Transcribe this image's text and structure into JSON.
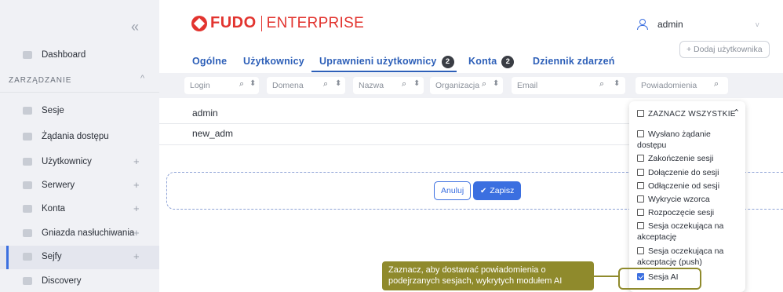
{
  "sidebar": {
    "collapse_glyph": "«",
    "section_title": "ZARZĄDZANIE",
    "items": [
      {
        "label": "Dashboard",
        "icon": "dashboard-icon"
      },
      {
        "label": "Sesje",
        "icon": "sessions-icon"
      },
      {
        "label": "Żądania dostępu",
        "icon": "access-requests-icon"
      },
      {
        "label": "Użytkownicy",
        "icon": "users-icon"
      },
      {
        "label": "Serwery",
        "icon": "servers-icon"
      },
      {
        "label": "Konta",
        "icon": "accounts-icon"
      },
      {
        "label": "Gniazda nasłuchiwania",
        "icon": "listeners-icon"
      },
      {
        "label": "Sejfy",
        "icon": "safes-icon"
      },
      {
        "label": "Discovery",
        "icon": "discovery-icon"
      }
    ],
    "plus": "+"
  },
  "header": {
    "logo_main": "FUDO",
    "logo_sub": "ENTERPRISE",
    "user_name": "admin",
    "add_user_label": "+ Dodaj użytkownika"
  },
  "tabs": [
    {
      "label": "Ogólne"
    },
    {
      "label": "Użytkownicy"
    },
    {
      "label": "Uprawnieni użytkownicy",
      "badge": "2"
    },
    {
      "label": "Konta",
      "badge": "2"
    },
    {
      "label": "Dziennik zdarzeń"
    }
  ],
  "filters": [
    {
      "placeholder": "Login"
    },
    {
      "placeholder": "Domena"
    },
    {
      "placeholder": "Nazwa"
    },
    {
      "placeholder": "Organizacja"
    },
    {
      "placeholder": "Email"
    },
    {
      "placeholder": "Powiadomienia"
    }
  ],
  "rows": [
    {
      "login": "admin"
    },
    {
      "login": "new_adm"
    }
  ],
  "edit_actions": {
    "cancel_label": "Anuluj",
    "save_label": "Zapisz"
  },
  "dropdown": {
    "select_all": "ZAZNACZ WSZYSTKIE",
    "options": [
      {
        "label": "Wysłano żądanie dostępu",
        "checked": false
      },
      {
        "label": "Zakończenie sesji",
        "checked": false
      },
      {
        "label": "Dołączenie do sesji",
        "checked": false
      },
      {
        "label": "Odłączenie od sesji",
        "checked": false
      },
      {
        "label": "Wykrycie wzorca",
        "checked": false
      },
      {
        "label": "Rozpoczęcie sesji",
        "checked": false
      },
      {
        "label": "Sesja oczekująca na akceptację",
        "checked": false
      },
      {
        "label": "Sesja oczekująca na akceptację (push)",
        "checked": false
      },
      {
        "label": "Sesja AI",
        "checked": true
      }
    ]
  },
  "callout": {
    "text": "Zaznacz, aby dostawać powiadomienia o podejrzanych sesjach, wykrytych modułem AI"
  },
  "colors": {
    "brand": "#e2342f",
    "accent": "#3b6fe0",
    "callout": "#8f8a2c"
  }
}
